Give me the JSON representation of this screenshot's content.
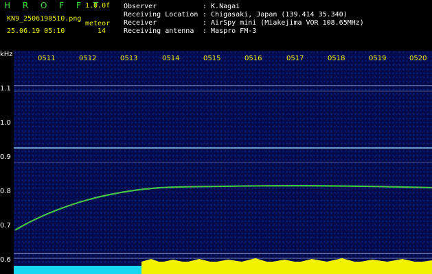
{
  "app": {
    "title": "H R O F F T",
    "version": "1.0.0f",
    "filename": "KN9_2506190510.png",
    "meteor_label": "meteor",
    "datetime": "25.06.19 05:10",
    "meteor_count": "14"
  },
  "info": {
    "observer_label": "Observer",
    "observer_value": ": K.Nagai",
    "location_label": "Receiving Location",
    "location_value": ": Chigasaki, Japan (139.414 35.340)",
    "receiver_label": "Receiver",
    "receiver_value": ": AirSpy mini (Miakejima VOR 108.65MHz)",
    "antenna_label": "Receiving antenna",
    "antenna_value": ": Maspro FM-3"
  },
  "axis": {
    "unit": "kHz",
    "y_ticks": [
      "1.1",
      "1.0",
      "0.9",
      "0.8",
      "0.7",
      "0.6"
    ],
    "time_ticks": [
      "0511",
      "0512",
      "0513",
      "0514",
      "0515",
      "0516",
      "0517",
      "0518",
      "0519",
      "0520"
    ]
  },
  "colors": {
    "bg": "#050a4a",
    "trace": "#3ee03e",
    "accent": "#f2f200",
    "cyan": "#17d6f0"
  }
}
